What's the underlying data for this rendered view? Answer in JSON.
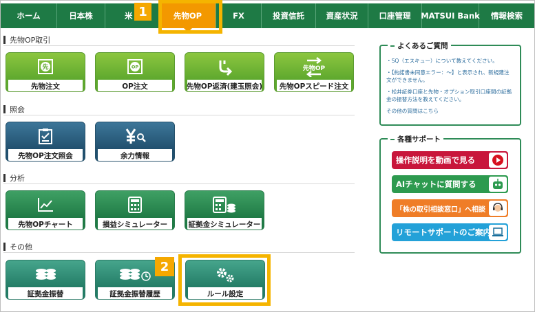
{
  "nav": {
    "items": [
      "ホーム",
      "日本株",
      "米",
      "先物OP",
      "FX",
      "投資信託",
      "資産状況",
      "口座管理",
      "MATSUI Bank",
      "情報検索"
    ],
    "active": "先物OP"
  },
  "callouts": {
    "one": "1",
    "two": "2"
  },
  "sections": {
    "trading": "先物OP取引",
    "inquiry": "照会",
    "analysis": "分析",
    "other": "その他"
  },
  "tiles": {
    "futures_order": "先物注文",
    "op_order": "OP注文",
    "futures_op_settle": "先物OP返済(建玉照会)",
    "futures_op_speed": "先物OPスピード注文",
    "futures_op_order_inquiry": "先物OP注文照会",
    "margin_info": "余力情報",
    "futures_op_chart": "先物OPチャート",
    "pl_simulator": "損益シミュレーター",
    "margin_simulator": "証拠金シミュレーター",
    "margin_transfer": "証拠金振替",
    "margin_transfer_history": "証拠金振替履歴",
    "rule_settings": "ルール設定"
  },
  "icon_text": {
    "futures": "先",
    "op": "OP",
    "futures_op": "先物OP"
  },
  "faq": {
    "title": "よくあるご質問",
    "items": [
      "・SQ（エスキュー）について教えてください。",
      "・【約諾書未同意エラー：～】と表示され、新規建注文ができません。",
      "・松井証券口座と先物・オプション取引口座間の証拠金の振替方法を教えてください。"
    ],
    "more": "その他の質問はこちら"
  },
  "support": {
    "title": "各種サポート",
    "buttons": [
      {
        "label": "操作説明を動画で見る",
        "color": "#c8163b"
      },
      {
        "label": "AIチャットに質問する",
        "color": "#2d9a4f"
      },
      {
        "label": "「株の取引相談窓口」へ相談",
        "color": "#ef7d27"
      },
      {
        "label": "リモートサポートのご案内",
        "color": "#23a1d8"
      }
    ]
  }
}
